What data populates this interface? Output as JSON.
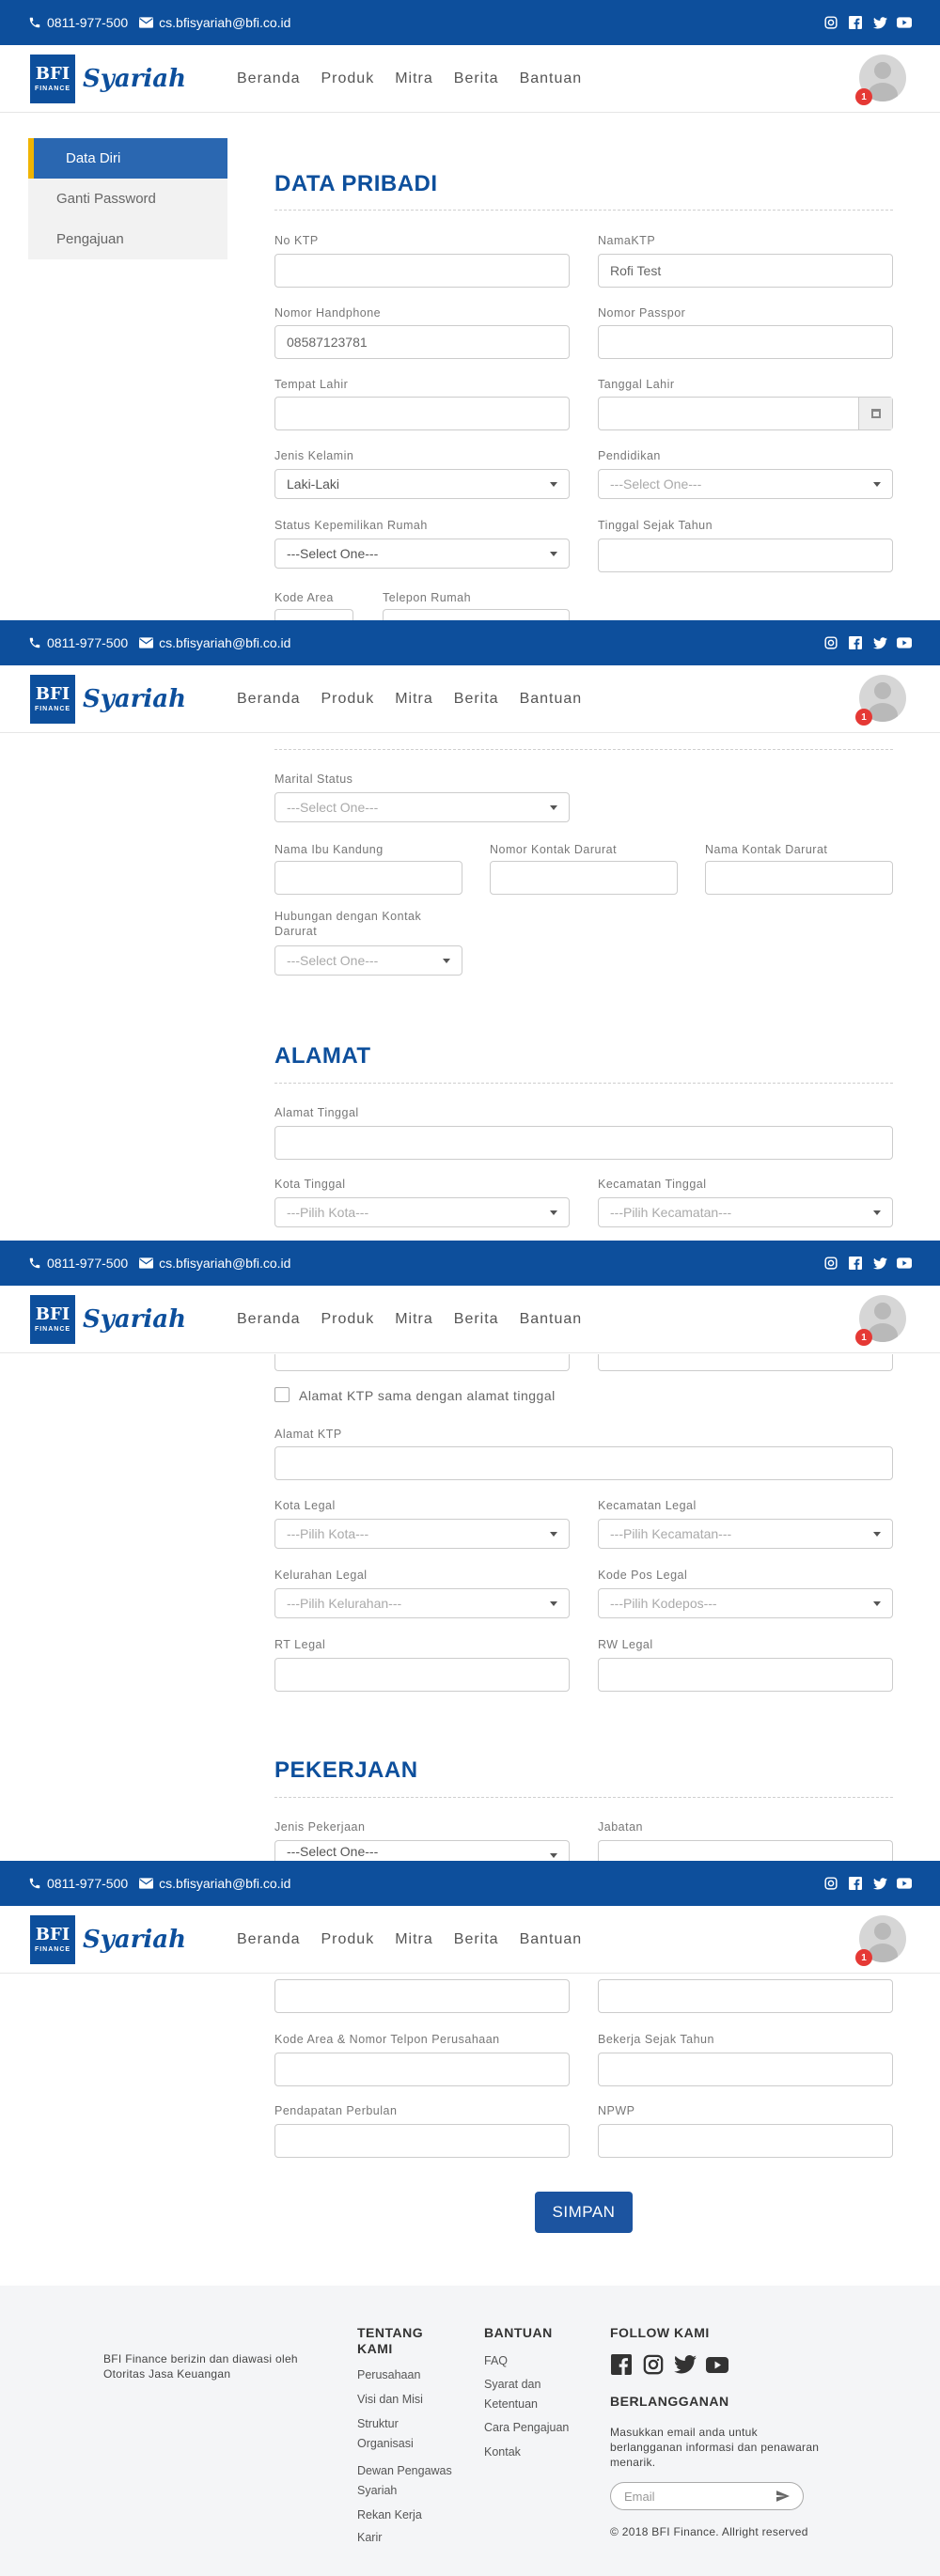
{
  "topbar": {
    "phone": "0811-977-500",
    "email": "cs.bfisyariah@bfi.co.id",
    "social_icons": [
      "instagram-icon",
      "facebook-icon",
      "twitter-icon",
      "youtube-icon"
    ]
  },
  "navbar": {
    "logo_box_text": "BFI",
    "logo_box_sub": "FINANCE",
    "logo_text": "Syariah",
    "menu": [
      "Beranda",
      "Produk",
      "Mitra",
      "Berita",
      "Bantuan"
    ],
    "notification_count": "1"
  },
  "sidebar": {
    "items": [
      {
        "label": "Data Diri",
        "active": true
      },
      {
        "label": "Ganti Password",
        "active": false
      },
      {
        "label": "Pengajuan",
        "active": false
      }
    ]
  },
  "data_pribadi": {
    "title": "DATA PRIBADI",
    "no_ktp_label": "No KTP",
    "nama_ktp_label": "NamaKTP",
    "nama_ktp_value": "Rofi Test",
    "no_hp_label": "Nomor Handphone",
    "no_hp_value": "08587123781",
    "no_paspor_label": "Nomor Passpor",
    "tempat_lahir_label": "Tempat Lahir",
    "tanggal_lahir_label": "Tanggal Lahir",
    "jenis_kelamin_label": "Jenis Kelamin",
    "jenis_kelamin_value": "Laki-Laki",
    "pendidikan_label": "Pendidikan",
    "pendidikan_value": "---Select One---",
    "status_rumah_label": "Status Kepemilikan Rumah",
    "status_rumah_value": "---Select One---",
    "tinggal_sejak_label": "Tinggal Sejak Tahun",
    "kode_area_label": "Kode Area",
    "telepon_rumah_label": "Telepon Rumah",
    "marital_label": "Marital Status",
    "marital_value": "---Select One---",
    "nama_ibu_label": "Nama Ibu Kandung",
    "kontak_darurat_label": "Nomor Kontak Darurat",
    "nama_kontak_darurat_label": "Nama Kontak Darurat",
    "hubungan_label": "Hubungan dengan Kontak Darurat",
    "hubungan_value": "---Select One---"
  },
  "alamat": {
    "title": "ALAMAT",
    "alamat_tinggal_label": "Alamat Tinggal",
    "kota_tinggal_label": "Kota Tinggal",
    "kota_tinggal_value": "---Pilih Kota---",
    "kecamatan_tinggal_label": "Kecamatan Tinggal",
    "kecamatan_tinggal_value": "---Pilih Kecamatan---",
    "same_address_label": "Alamat KTP sama dengan alamat tinggal",
    "alamat_ktp_label": "Alamat KTP",
    "kota_legal_label": "Kota Legal",
    "kota_legal_value": "---Pilih Kota---",
    "kecamatan_legal_label": "Kecamatan Legal",
    "kecamatan_legal_value": "---Pilih Kecamatan---",
    "kelurahan_legal_label": "Kelurahan Legal",
    "kelurahan_legal_value": "---Pilih Kelurahan---",
    "kodepos_legal_label": "Kode Pos Legal",
    "kodepos_legal_value": "---Pilih Kodepos---",
    "rt_legal_label": "RT Legal",
    "rw_legal_label": "RW Legal"
  },
  "pekerjaan": {
    "title": "PEKERJAAN",
    "jenis_pekerjaan_label": "Jenis Pekerjaan",
    "jenis_pekerjaan_value": "---Select One---",
    "jabatan_label": "Jabatan",
    "kode_area_perusahaan_label": "Kode Area & Nomor Telpon Perusahaan",
    "bekerja_sejak_label": "Bekerja Sejak Tahun",
    "pendapatan_label": "Pendapatan Perbulan",
    "npwp_label": "NPWP"
  },
  "save_button": "SIMPAN",
  "footer": {
    "ojk_text": "BFI Finance berizin dan diawasi oleh Otoritas Jasa Keuangan",
    "tentang_title": "TENTANG KAMI",
    "tentang_links": [
      "Perusahaan",
      "Visi dan Misi",
      "Struktur Organisasi",
      "Dewan Pengawas Syariah",
      "Rekan Kerja",
      "Karir"
    ],
    "bantuan_title": "BANTUAN",
    "bantuan_links": [
      "FAQ",
      "Syarat dan Ketentuan",
      "Cara Pengajuan",
      "Kontak"
    ],
    "follow_title": "FOLLOW KAMI",
    "follow_icons": [
      "facebook-icon",
      "instagram-icon",
      "twitter-icon",
      "youtube-icon"
    ],
    "subscribe_title": "BERLANGGANAN",
    "subscribe_text": "Masukkan email anda untuk berlangganan informasi dan penawaran menarik.",
    "email_placeholder": "Email",
    "copyright": "© 2018 BFI Finance. Allright reserved"
  }
}
